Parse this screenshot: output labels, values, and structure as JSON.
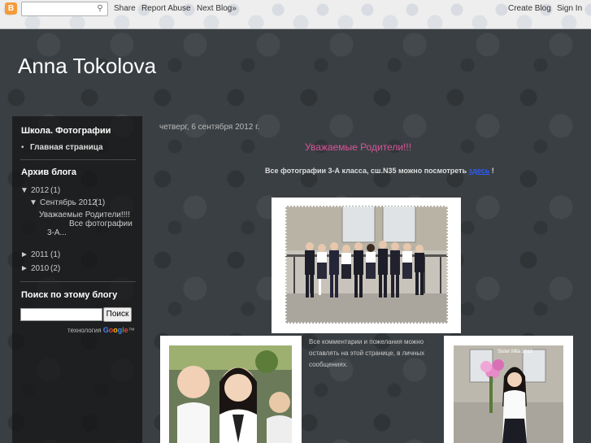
{
  "navbar": {
    "logo_letter": "B",
    "search_placeholder": "",
    "search_icon": "search-icon",
    "links": [
      "Share",
      "Report Abuse",
      "Next Blog»"
    ],
    "right_links": [
      "Create Blog",
      "Sign In"
    ]
  },
  "header": {
    "title": "Anna Tokolova"
  },
  "sidebar": {
    "pages_title": "Школа. Фотографии",
    "pages": [
      "Главная страница"
    ],
    "archive_title": "Архив блога",
    "archive": {
      "y2012": {
        "toggle": "▼",
        "label": "2012",
        "count": "(1)"
      },
      "sep2012": {
        "toggle": "▼",
        "label": "Сентябрь 2012",
        "count": "(1)"
      },
      "post_line1": "Уважаемые Родители!!!!",
      "post_line2": "Все фотографии",
      "post_line3": "3-А...",
      "y2011": {
        "toggle": "►",
        "label": "2011",
        "count": "(1)"
      },
      "y2010": {
        "toggle": "►",
        "label": "2010",
        "count": "(2)"
      }
    },
    "search_title": "Поиск по этому блогу",
    "search_button": "Поиск",
    "powered_by": "технология",
    "google": [
      "G",
      "o",
      "o",
      "g",
      "l",
      "e"
    ],
    "tm": "™"
  },
  "post": {
    "date": "четверг, 6 сентября 2012 г.",
    "title": "Уважаемые Родители!!!",
    "subtitle": "Все фотографии 3-А класса, сш.N35 можно посмотреть",
    "subtitle_link": "здесь",
    "subtitle_end": "!",
    "comment_line1": "Все комментарии и пожелания можно",
    "comment_line2": "оставлять на этой странице, в личных",
    "comment_line3": "сообщениях.",
    "photo_badge": "Sister Mila 2012"
  },
  "colors": {
    "title_pink": "#d9559b",
    "link_blue": "#2a5cff",
    "sidebar_bg": "#141414"
  }
}
